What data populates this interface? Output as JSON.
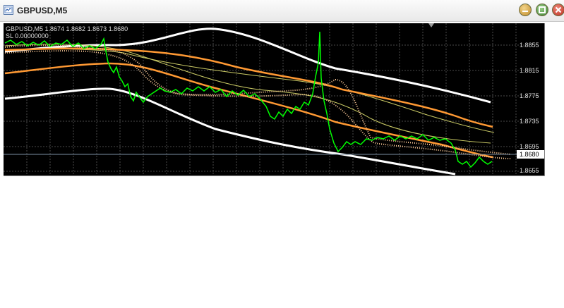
{
  "window": {
    "title": "GBPUSD,M5",
    "buttons": {
      "minimize": "minimize-icon",
      "maximize": "maximize-icon",
      "close": "close-icon"
    }
  },
  "chart": {
    "header_line": "GBPUSD,M5   1.8674 1.8682 1.8673 1.8680",
    "indicator_line": "SL 0.00000000",
    "price_label": "1.8680",
    "y_ticks": [
      "1.8855",
      "1.8815",
      "1.8775",
      "1.8735",
      "1.8695",
      "1.8655"
    ],
    "colors": {
      "background": "#000000",
      "grid": "#4a4a4a",
      "price": "#00ff00",
      "bands": "#ffffff",
      "trend": "#ff9933",
      "signal": "#ffcc99",
      "ma_thin": "#cccc66"
    }
  }
}
